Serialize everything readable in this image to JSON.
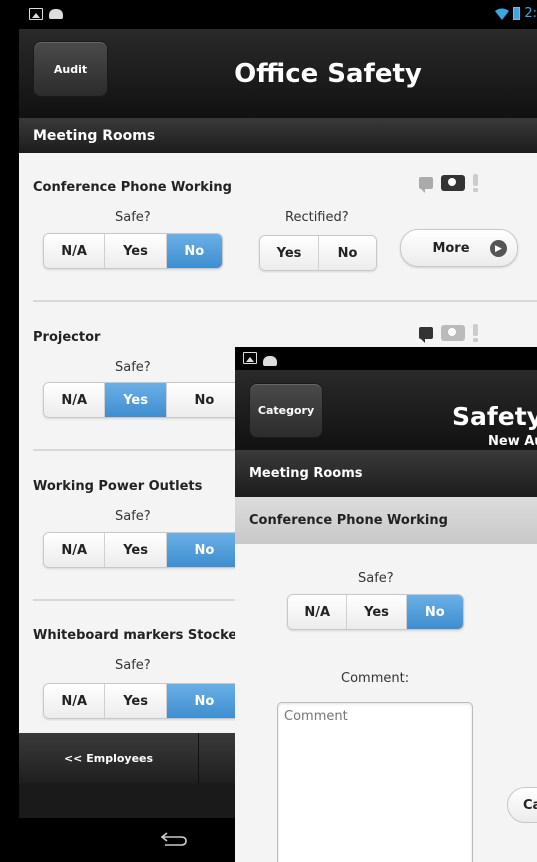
{
  "status": {
    "time": "2:"
  },
  "header": {
    "left_button": "Audit",
    "title": "Office Safety"
  },
  "section": "Meeting Rooms",
  "labels": {
    "safe": "Safe?",
    "rectified": "Rectified?"
  },
  "items": [
    {
      "title": "Conference Phone Working",
      "safe_options": [
        "N/A",
        "Yes",
        "No"
      ],
      "safe_selected": "No",
      "rectified_options": [
        "Yes",
        "No"
      ],
      "more_label": "More"
    },
    {
      "title": "Projector",
      "safe_options": [
        "N/A",
        "Yes",
        "No"
      ],
      "safe_selected": "Yes"
    },
    {
      "title": "Working Power Outlets",
      "safe_options": [
        "N/A",
        "Yes",
        "No"
      ],
      "safe_selected": "No"
    },
    {
      "title": "Whiteboard markers Stocked",
      "safe_options": [
        "N/A",
        "Yes",
        "No"
      ],
      "safe_selected": "No"
    }
  ],
  "bottom": {
    "employees_button": "<< Employees"
  },
  "overlay": {
    "left_button": "Category",
    "title": "Safety",
    "subtitle": "New Au",
    "section": "Meeting Rooms",
    "sub_section": "Conference Phone Working",
    "safe_label": "Safe?",
    "safe_options": [
      "N/A",
      "Yes",
      "No"
    ],
    "safe_selected": "No",
    "comment_label": "Comment:",
    "comment_placeholder": "Comment",
    "cancel_label": "Ca"
  },
  "colors": {
    "accent": "#4a9ad8",
    "bar": "#222222"
  }
}
